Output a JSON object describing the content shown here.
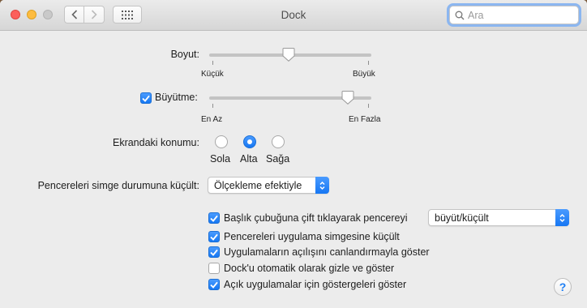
{
  "window": {
    "title": "Dock"
  },
  "search": {
    "placeholder": "Ara"
  },
  "size": {
    "label": "Boyut:",
    "min_label": "Küçük",
    "max_label": "Büyük",
    "value_fraction": 0.49
  },
  "magnification": {
    "label": "Büyütme:",
    "checked": true,
    "min_label": "En Az",
    "max_label": "En Fazla",
    "value_fraction": 0.87
  },
  "position": {
    "label": "Ekrandaki konumu:",
    "options": [
      "Sola",
      "Alta",
      "Sağa"
    ],
    "selected": "Alta"
  },
  "minimize": {
    "label": "Pencereleri simge durumuna küçült:",
    "value": "Ölçekleme efektiyle"
  },
  "options": {
    "double_click": {
      "label": "Başlık çubuğuna çift tıklayarak pencereyi",
      "checked": true,
      "popup_value": "büyüt/küçült"
    },
    "minimize_into_icon": {
      "label": "Pencereleri uygulama simgesine küçült",
      "checked": true
    },
    "animate": {
      "label": "Uygulamaların açılışını canlandırmayla göster",
      "checked": true
    },
    "autohide": {
      "label": "Dock'u otomatik olarak gizle ve göster",
      "checked": false
    },
    "indicators": {
      "label": "Açık uygulamalar için göstergeleri göster",
      "checked": true
    }
  },
  "help": {
    "label": "?"
  },
  "colors": {
    "accent": "#1677f3",
    "window_bg": "#ececec"
  }
}
